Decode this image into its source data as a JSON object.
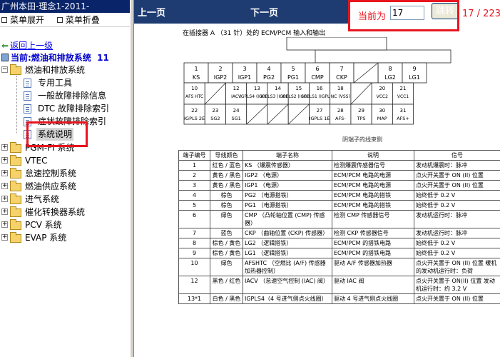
{
  "left_panel": {
    "title": "广州本田-理念1-2011-",
    "toolbar": {
      "expand_label": "菜单展开",
      "collapse_label": "菜单折叠"
    },
    "back_label": "返回上一级",
    "current_label": "当前:燃油和排放系统",
    "current_count": "11",
    "tree": [
      {
        "label": "燃油和排放系统",
        "expanded": true
      },
      {
        "label": "专用工具"
      },
      {
        "label": "一般故障排除信息"
      },
      {
        "label": "DTC 故障排除索引"
      },
      {
        "label": "症状故障排除索引"
      },
      {
        "label": "系统说明",
        "selected": true
      },
      {
        "label": "PGM-FI 系统"
      },
      {
        "label": "VTEC"
      },
      {
        "label": "怠速控制系统"
      },
      {
        "label": "燃油供应系统"
      },
      {
        "label": "进气系统"
      },
      {
        "label": "催化转换器系统"
      },
      {
        "label": "PCV 系统"
      },
      {
        "label": "EVAP 系统"
      }
    ]
  },
  "nav": {
    "prev_label": "上一页",
    "next_label": "下一页",
    "current_label": "当前为",
    "page_value": "17",
    "go_label": "跳转",
    "page_count": "17 / 223"
  },
  "document": {
    "caption": "在插接器 A （31 针）处的 ECM/PCM 输入和输出",
    "connector_caption": "阴端子的线束侧",
    "connector": {
      "row1": [
        {
          "n": "1",
          "s": "KS"
        },
        {
          "n": "2",
          "s": "IGP2"
        },
        {
          "n": "3",
          "s": "IGP1"
        },
        {
          "n": "4",
          "s": "PG2"
        },
        {
          "n": "5",
          "s": "PG1"
        },
        {
          "n": "6",
          "s": "CMP"
        },
        {
          "n": "7",
          "s": "CKP"
        },
        {
          "n": "8",
          "s": "LG2"
        },
        {
          "n": "9",
          "s": "LG1"
        }
      ],
      "row2": [
        {
          "n": "10",
          "s": "AFS HTC"
        },
        {
          "n": "12",
          "s": "IACV"
        },
        {
          "n": "13",
          "s": "IGPLS4 (IGPLS4)"
        },
        {
          "n": "14",
          "s": "IGPLS3 (IGPLS3)"
        },
        {
          "n": "15",
          "s": "IGPLS2 (IGPLS2)"
        },
        {
          "n": "16",
          "s": "IGPLS1 (IGPLS1)"
        },
        {
          "n": "18",
          "s": "NC (VSS)"
        },
        {
          "n": "20",
          "s": "VCC2"
        },
        {
          "n": "21",
          "s": "VCC1"
        }
      ],
      "row3": [
        {
          "n": "22",
          "s": "IGPLS 2E"
        },
        {
          "n": "23",
          "s": "SG2"
        },
        {
          "n": "24",
          "s": "SG1"
        },
        {
          "n": "27",
          "s": "IGPLS 1E"
        },
        {
          "n": "28",
          "s": "AFS-"
        },
        {
          "n": "29",
          "s": "TPS"
        },
        {
          "n": "30",
          "s": "MAP"
        },
        {
          "n": "31",
          "s": "AFS+"
        }
      ]
    },
    "table": {
      "headers": [
        "端子编号",
        "导线颜色",
        "端子名称",
        "说明",
        "信号"
      ],
      "rows": [
        [
          "1",
          "红色 / 蓝色",
          "KS （爆震传感器）",
          "检测爆震传感器信号",
          "发动机爆震时：脉冲"
        ],
        [
          "2",
          "黄色 / 黑色",
          "IGP2 （电源）",
          "ECM/PCM 电路的电源",
          "点火开关置于 ON (II) 位置"
        ],
        [
          "3",
          "黄色 / 黑色",
          "IGP1 （电源）",
          "ECM/PCM 电路的电源",
          "点火开关置于 ON (II) 位置"
        ],
        [
          "4",
          "棕色",
          "PG2 （电源搭铁）",
          "ECM/PCM 电路的搭铁",
          "始终低于 0.2 V"
        ],
        [
          "5",
          "棕色",
          "PG1 （电源搭铁）",
          "ECM/PCM 电路的搭铁",
          "始终低于 0.2 V"
        ],
        [
          "6",
          "绿色",
          "CMP （凸轮轴位置 (CMP) 传感器）",
          "检测 CMP 传感器信号",
          "发动机运行时：脉冲"
        ],
        [
          "7",
          "蓝色",
          "CKP （曲轴位置 (CKP) 传感器）",
          "检测 CKP 传感器信号",
          "发动机运行时：脉冲"
        ],
        [
          "8",
          "棕色 / 黄色",
          "LG2 （逻辑搭铁）",
          "ECM/PCM 的搭铁电路",
          "始终低于 0.2 V"
        ],
        [
          "9",
          "棕色 / 黄色",
          "LG1 （逻辑搭铁）",
          "ECM/PCM 的搭铁电路",
          "始终低于 0.2 V"
        ],
        [
          "10",
          "绿色",
          "AFSHTC （空燃比 (A/F) 传感器加热器控制）",
          "驱动 A/F 传感器加热器",
          "点火开关置于 ON (II) 位置 暖机的发动机运行时：负荷"
        ],
        [
          "12",
          "黑色 / 红色",
          "IACV （怠速空气控制 (IAC) 阀）",
          "驱动 IAC 阀",
          "点火开关置于 ON(II) 位置 发动机运行时：约 3.2 V"
        ],
        [
          "13*1",
          "白色 / 黑色",
          "IGPLS4（4 号进气侧点火线圈）",
          "驱动 4 号进气侧点火线圈",
          "点火开关置于 ON (II) 位置"
        ]
      ]
    }
  }
}
